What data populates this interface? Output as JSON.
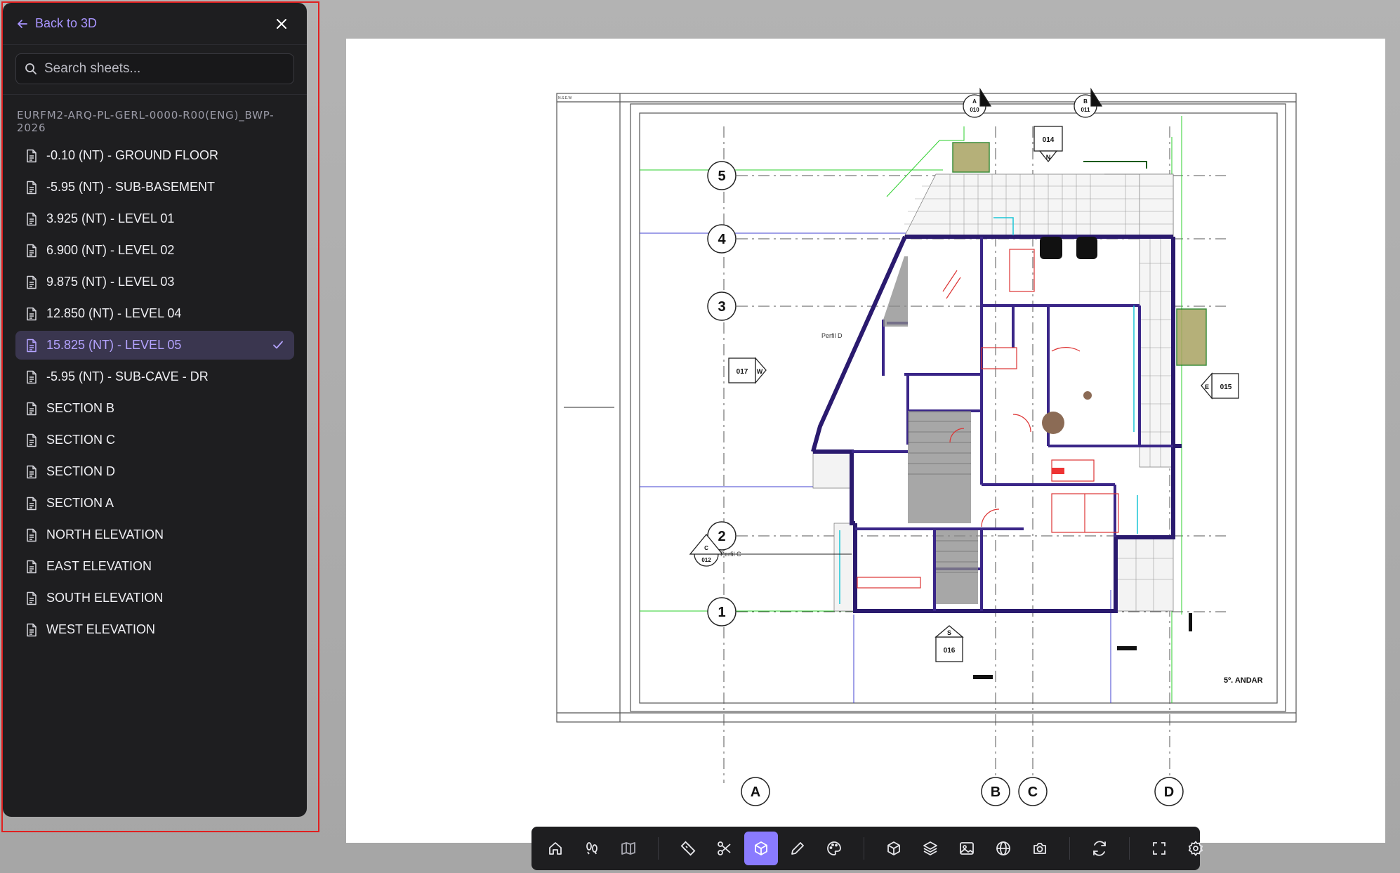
{
  "sidebar": {
    "back_label": "Back to 3D",
    "search_placeholder": "Search sheets...",
    "group_title": "EURFM2-ARQ-PL-GERL-0000-R00(ENG)_BWP-2026",
    "sheets": [
      {
        "label": "-0.10 (NT) - GROUND FLOOR",
        "selected": false
      },
      {
        "label": "-5.95 (NT) - SUB-BASEMENT",
        "selected": false
      },
      {
        "label": "3.925 (NT) - LEVEL 01",
        "selected": false
      },
      {
        "label": "6.900 (NT) - LEVEL 02",
        "selected": false
      },
      {
        "label": "9.875 (NT) - LEVEL 03",
        "selected": false
      },
      {
        "label": "12.850 (NT) - LEVEL 04",
        "selected": false
      },
      {
        "label": "15.825 (NT) - LEVEL 05",
        "selected": true
      },
      {
        "label": "-5.95 (NT) - SUB-CAVE - DR",
        "selected": false
      },
      {
        "label": "SECTION B",
        "selected": false
      },
      {
        "label": "SECTION C",
        "selected": false
      },
      {
        "label": "SECTION D",
        "selected": false
      },
      {
        "label": "SECTION A",
        "selected": false
      },
      {
        "label": "NORTH ELEVATION",
        "selected": false
      },
      {
        "label": "EAST ELEVATION",
        "selected": false
      },
      {
        "label": "SOUTH ELEVATION",
        "selected": false
      },
      {
        "label": "WEST ELEVATION",
        "selected": false
      }
    ]
  },
  "drawing": {
    "grid_rows": [
      "5",
      "4",
      "3",
      "2",
      "1"
    ],
    "grid_cols": [
      "A",
      "B",
      "C",
      "D"
    ],
    "tags": {
      "t010": "010",
      "t011": "011",
      "t014": "014",
      "t017": "017",
      "t015": "015",
      "t012": "012",
      "t016": "016",
      "ta": "A",
      "tb": "B",
      "tc": "C",
      "tn": "N",
      "tw": "W",
      "te": "E",
      "ts": "S"
    },
    "level_label": "5º. ANDAR",
    "section_labels": {
      "perfil_d": "Perfil D",
      "perfil_c": "Perfil C"
    }
  },
  "toolbar": {
    "icons": [
      "home-icon",
      "walk-icon",
      "map-icon",
      "ruler-icon",
      "scissors-icon",
      "cube-icon",
      "pencil-icon",
      "palette-icon",
      "box-icon",
      "layers-icon",
      "image-icon",
      "globe-icon",
      "camera-icon",
      "refresh-icon",
      "fullscreen-icon",
      "settings-icon"
    ],
    "active": "cube-icon"
  },
  "colors": {
    "accent": "#8a7bff",
    "accent_text": "#b4a3ff",
    "panel": "#1e1e20",
    "highlight": "#e02020"
  }
}
